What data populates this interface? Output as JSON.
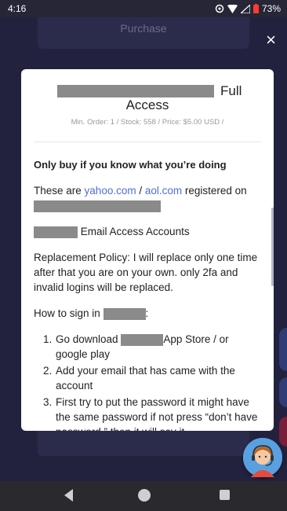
{
  "status_bar": {
    "time": "4:16",
    "battery": "73%"
  },
  "background": {
    "purchase_label": "Purchase"
  },
  "modal": {
    "close_label": "×",
    "title_suffix": "Full",
    "title_line2": "Access",
    "subinfo": "Min. Order: 1 / Stock: 558 / Price: $5.00 USD /",
    "warning": "Only buy if you know what you’re doing",
    "registered_prefix": "These are ",
    "yahoo": "yahoo.com",
    "sep": " / ",
    "aol": "aol.com",
    "registered_suffix": " registered on",
    "email_access": "Email Access Accounts",
    "policy": "Replacement Policy: I will replace only one time after that you are on your own. only 2fa and invalid logins will be replaced.",
    "howto_prefix": "How to sign in ",
    "howto_suffix": ":",
    "steps": [
      {
        "num": "1.",
        "pre": "Go download ",
        "post": "App Store / or google play"
      },
      {
        "num": "2.",
        "pre": "Add your email that has came with the account",
        "post": ""
      },
      {
        "num": "3.",
        "pre": "First try to put the password it might have the same password if not press “don’t have password ” then it will say it",
        "post": ""
      }
    ]
  },
  "icons": {
    "close": "close-icon",
    "back": "back-triangle-icon",
    "home": "home-circle-icon",
    "recent": "recent-square-icon",
    "support": "support-agent-icon"
  },
  "colors": {
    "link": "#4f6fd9",
    "battery": "#ff3b30"
  }
}
